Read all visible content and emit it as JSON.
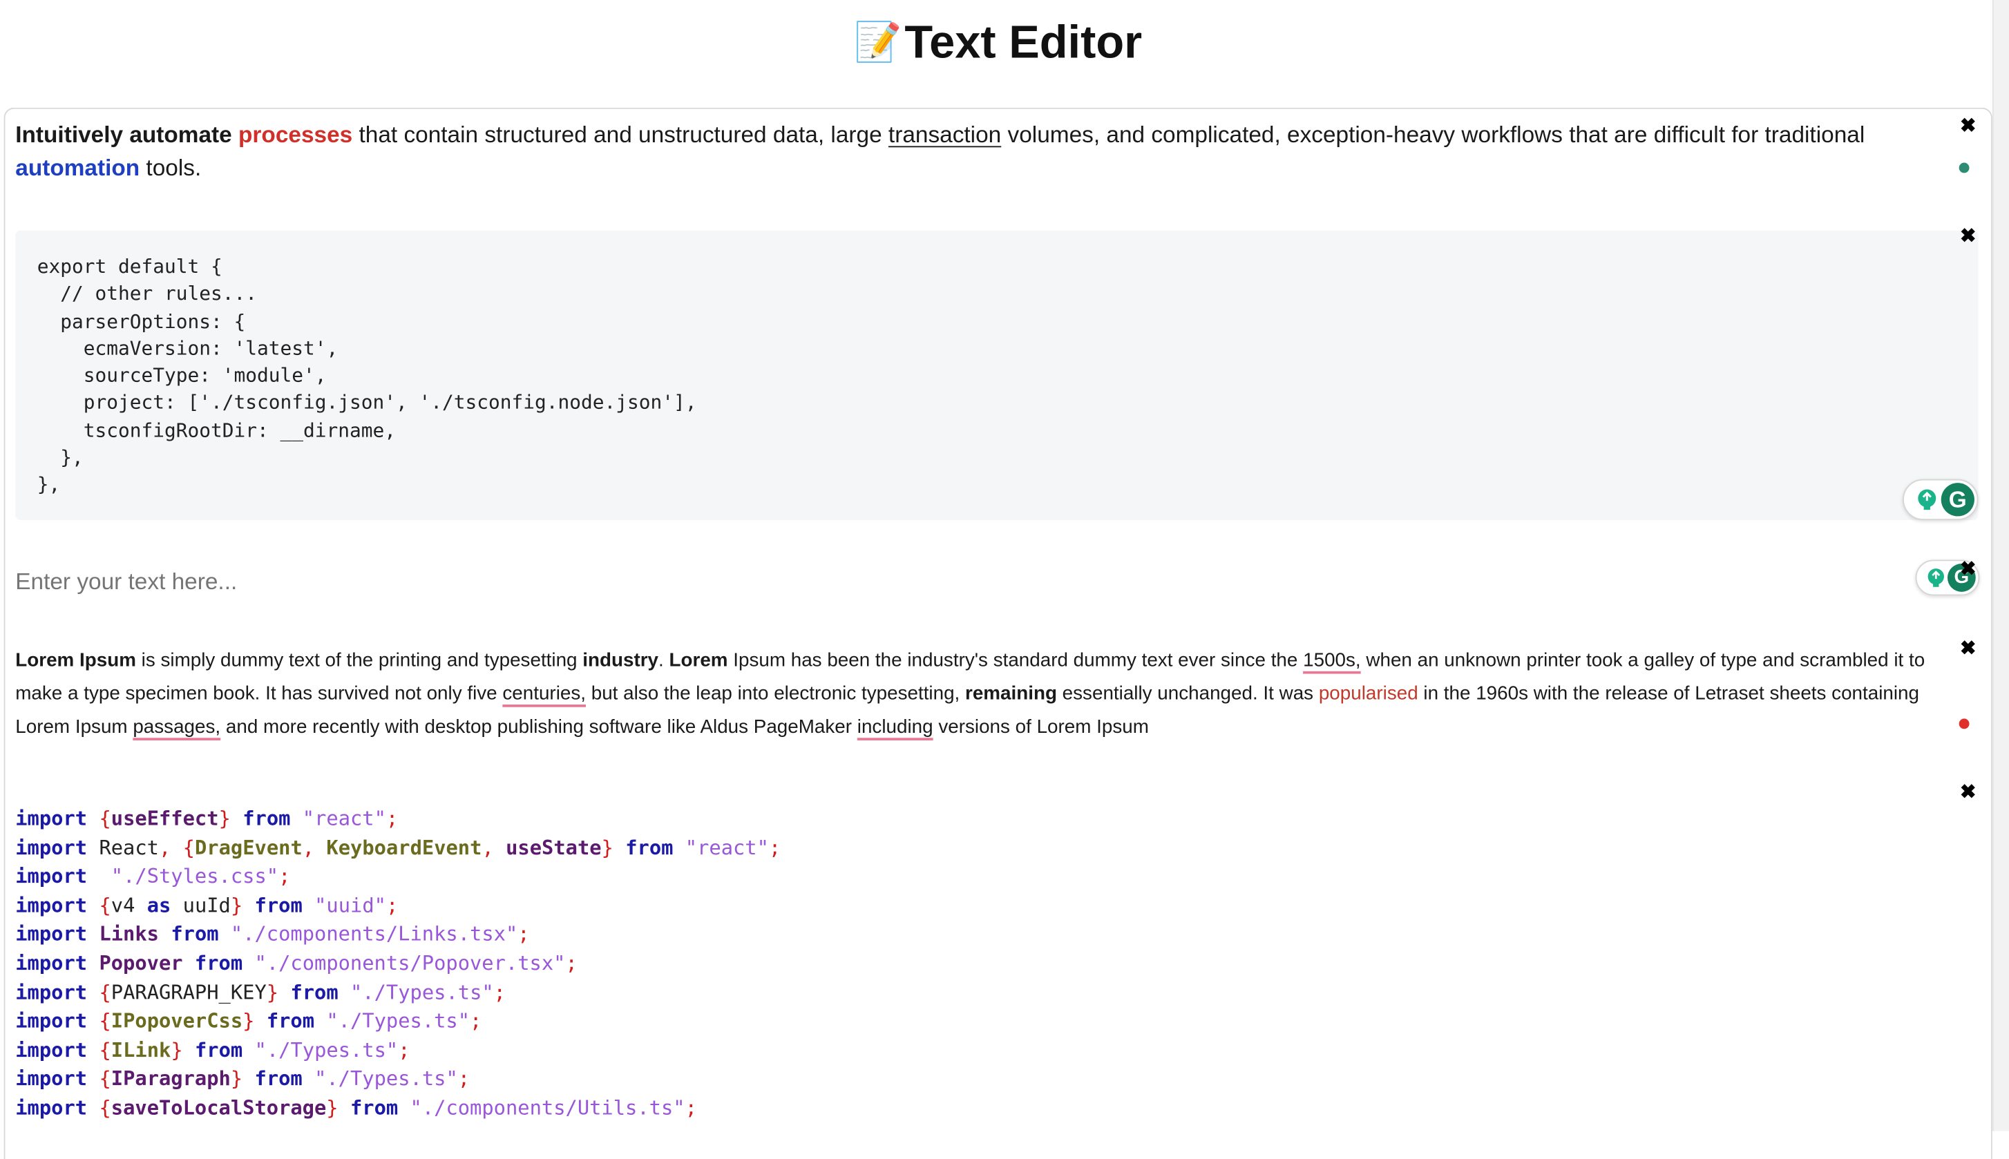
{
  "page": {
    "title_emoji": "📝",
    "title": "Text Editor"
  },
  "paragraph1": {
    "bold_lead": "Intuitively automate",
    "red_word": "processes",
    "text_a": " that contain structured and unstructured data, large ",
    "underlined": "transaction",
    "text_b": " volumes, and complicated, exception-heavy workflows that are difficult for traditional ",
    "blue_word": "automation",
    "text_c": " tools."
  },
  "code_block1": {
    "content": "export default {\n  // other rules...\n  parserOptions: {\n    ecmaVersion: 'latest',\n    sourceType: 'module',\n    project: ['./tsconfig.json', './tsconfig.node.json'],\n    tsconfigRootDir: __dirname,\n  },\n},"
  },
  "input": {
    "placeholder": "Enter your text here..."
  },
  "paragraph2": {
    "t1": "Lorem Ipsum",
    "t2": " is simply dummy text of the printing and typesetting ",
    "t3": "industry",
    "t4": ". ",
    "t5": "Lorem",
    "t6": " Ipsum has been the industry's standard dummy text ever since the ",
    "t7": "1500s,",
    "t8": " when an unknown printer took a galley of type and scrambled it to make a type specimen book. It has survived not only five ",
    "t9": "centuries,",
    "t10": " but also the leap into electronic typesetting, ",
    "t11": "remaining",
    "t12": " essentially unchanged. It was ",
    "t13": "popularised",
    "t14": " in the 1960s with the release of Letraset sheets containing Lorem Ipsum ",
    "t15": "passages,",
    "t16": " and more recently with desktop publishing software like Aldus PageMaker ",
    "t17": "including",
    "t18": " versions of Lorem Ipsum"
  },
  "code_block2": {
    "lines": [
      [
        "import",
        "{",
        "useEffect",
        "}",
        "from",
        "\"react\"",
        ";"
      ],
      [
        "import",
        "React, {",
        "DragEvent, KeyboardEvent, useState",
        "}",
        "from",
        "\"react\"",
        ";"
      ],
      [
        "import",
        "",
        "",
        "",
        "",
        "\"./Styles.css\"",
        ";"
      ],
      [
        "import",
        "{",
        "v4 as uuId",
        "}",
        "from",
        "\"uuid\"",
        ";"
      ],
      [
        "import",
        "",
        "Links",
        "",
        "from",
        "\"./components/Links.tsx\"",
        ";"
      ],
      [
        "import",
        "",
        "Popover",
        "",
        "from",
        "\"./components/Popover.tsx\"",
        ";"
      ],
      [
        "import",
        "{",
        "PARAGRAPH_KEY",
        "}",
        "from",
        "\"./Types.ts\"",
        ";"
      ],
      [
        "import",
        "{",
        "IPopoverCss",
        "}",
        "from",
        "\"./Types.ts\"",
        ";"
      ],
      [
        "import",
        "{",
        "ILink",
        "}",
        "from",
        "\"./Types.ts\"",
        ";"
      ],
      [
        "import",
        "{",
        "IParagraph",
        "}",
        "from",
        "\"./Types.ts\"",
        ";"
      ],
      [
        "import",
        "{",
        "saveToLocalStorage",
        "}",
        "from",
        "\"./components/Utils.ts\"",
        ";"
      ]
    ]
  },
  "controls": {
    "close_glyph": "✖",
    "grammarly_glyph": "G",
    "status_green": "#2e8b74",
    "status_red": "#e0302a"
  }
}
